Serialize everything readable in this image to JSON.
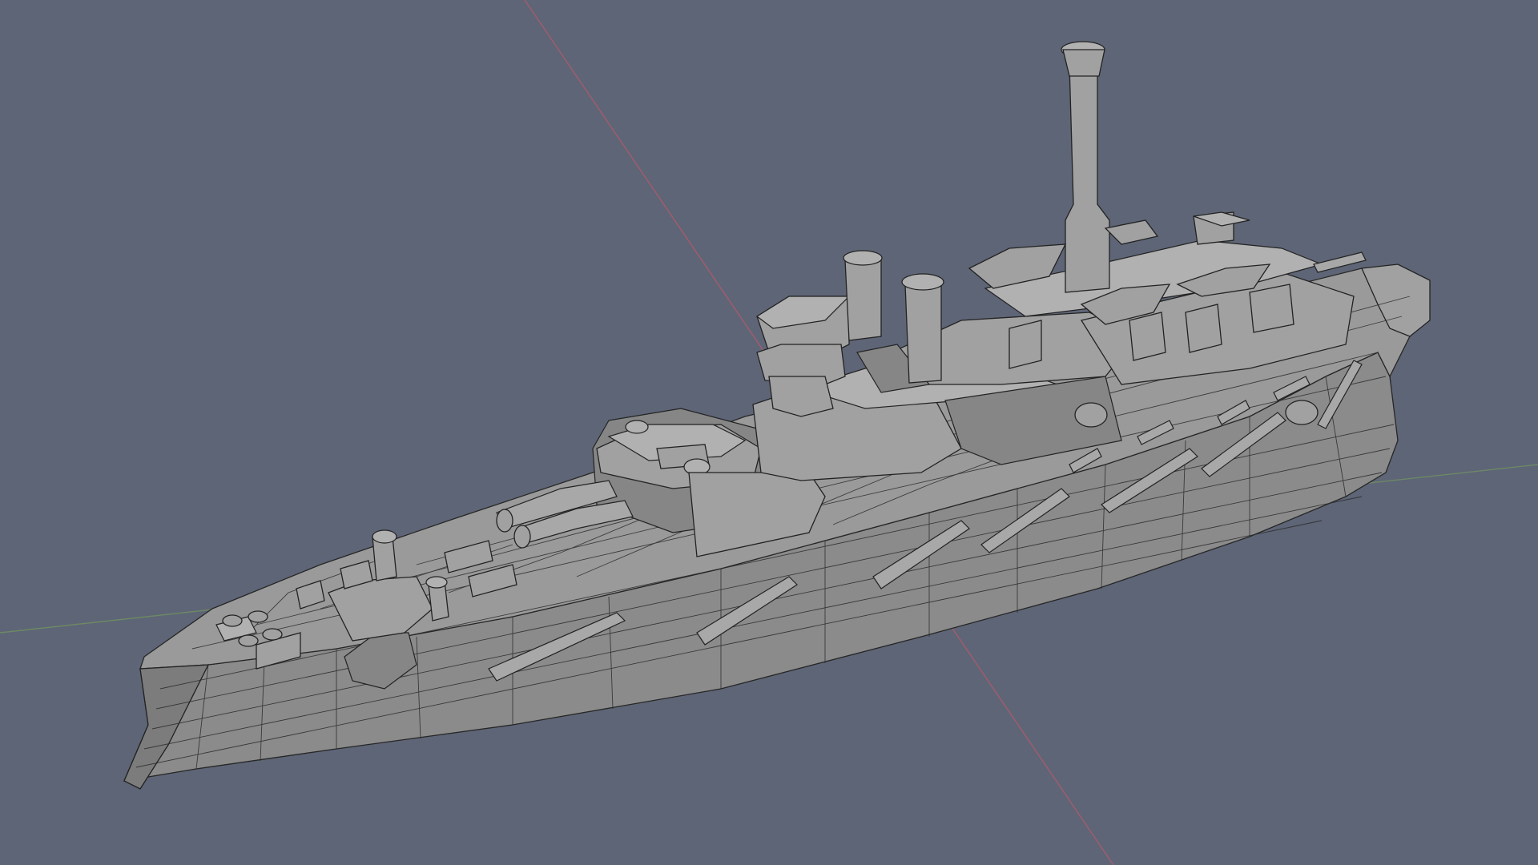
{
  "viewport": {
    "background_color": "#5e6576",
    "axis_x_color": "#b45a6b",
    "axis_y_color": "#6f8f63"
  },
  "scene": {
    "object": "battleship-mesh",
    "display_mode": "wireframe-on-shaded",
    "mesh_color": "#9a9a9a",
    "wire_color": "#262626"
  }
}
